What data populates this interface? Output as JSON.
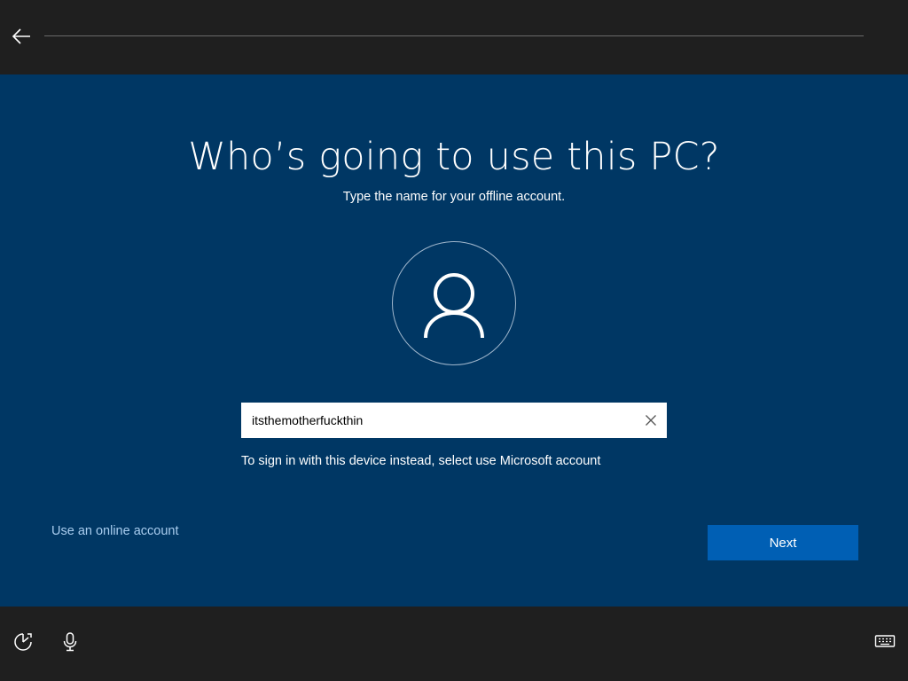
{
  "header": {
    "back_icon": "back-arrow-icon"
  },
  "main": {
    "title": "Who’s going to use this PC?",
    "subtitle": "Type the name for your offline account.",
    "avatar_icon": "user-icon",
    "name_input": {
      "value": "itsthemotherfuckthin",
      "placeholder": ""
    },
    "clear_icon": "close-icon",
    "hint": "To sign in with this device instead, select use Microsoft account",
    "online_account_link": "Use an online account",
    "next_label": "Next"
  },
  "footer": {
    "icons": [
      "ease-of-access-icon",
      "microphone-icon",
      "keyboard-icon"
    ]
  },
  "colors": {
    "background_dark": "#1f1f1f",
    "panel_blue": "#003764",
    "button_blue": "#005fb4",
    "link_blue": "#a9cdef"
  }
}
